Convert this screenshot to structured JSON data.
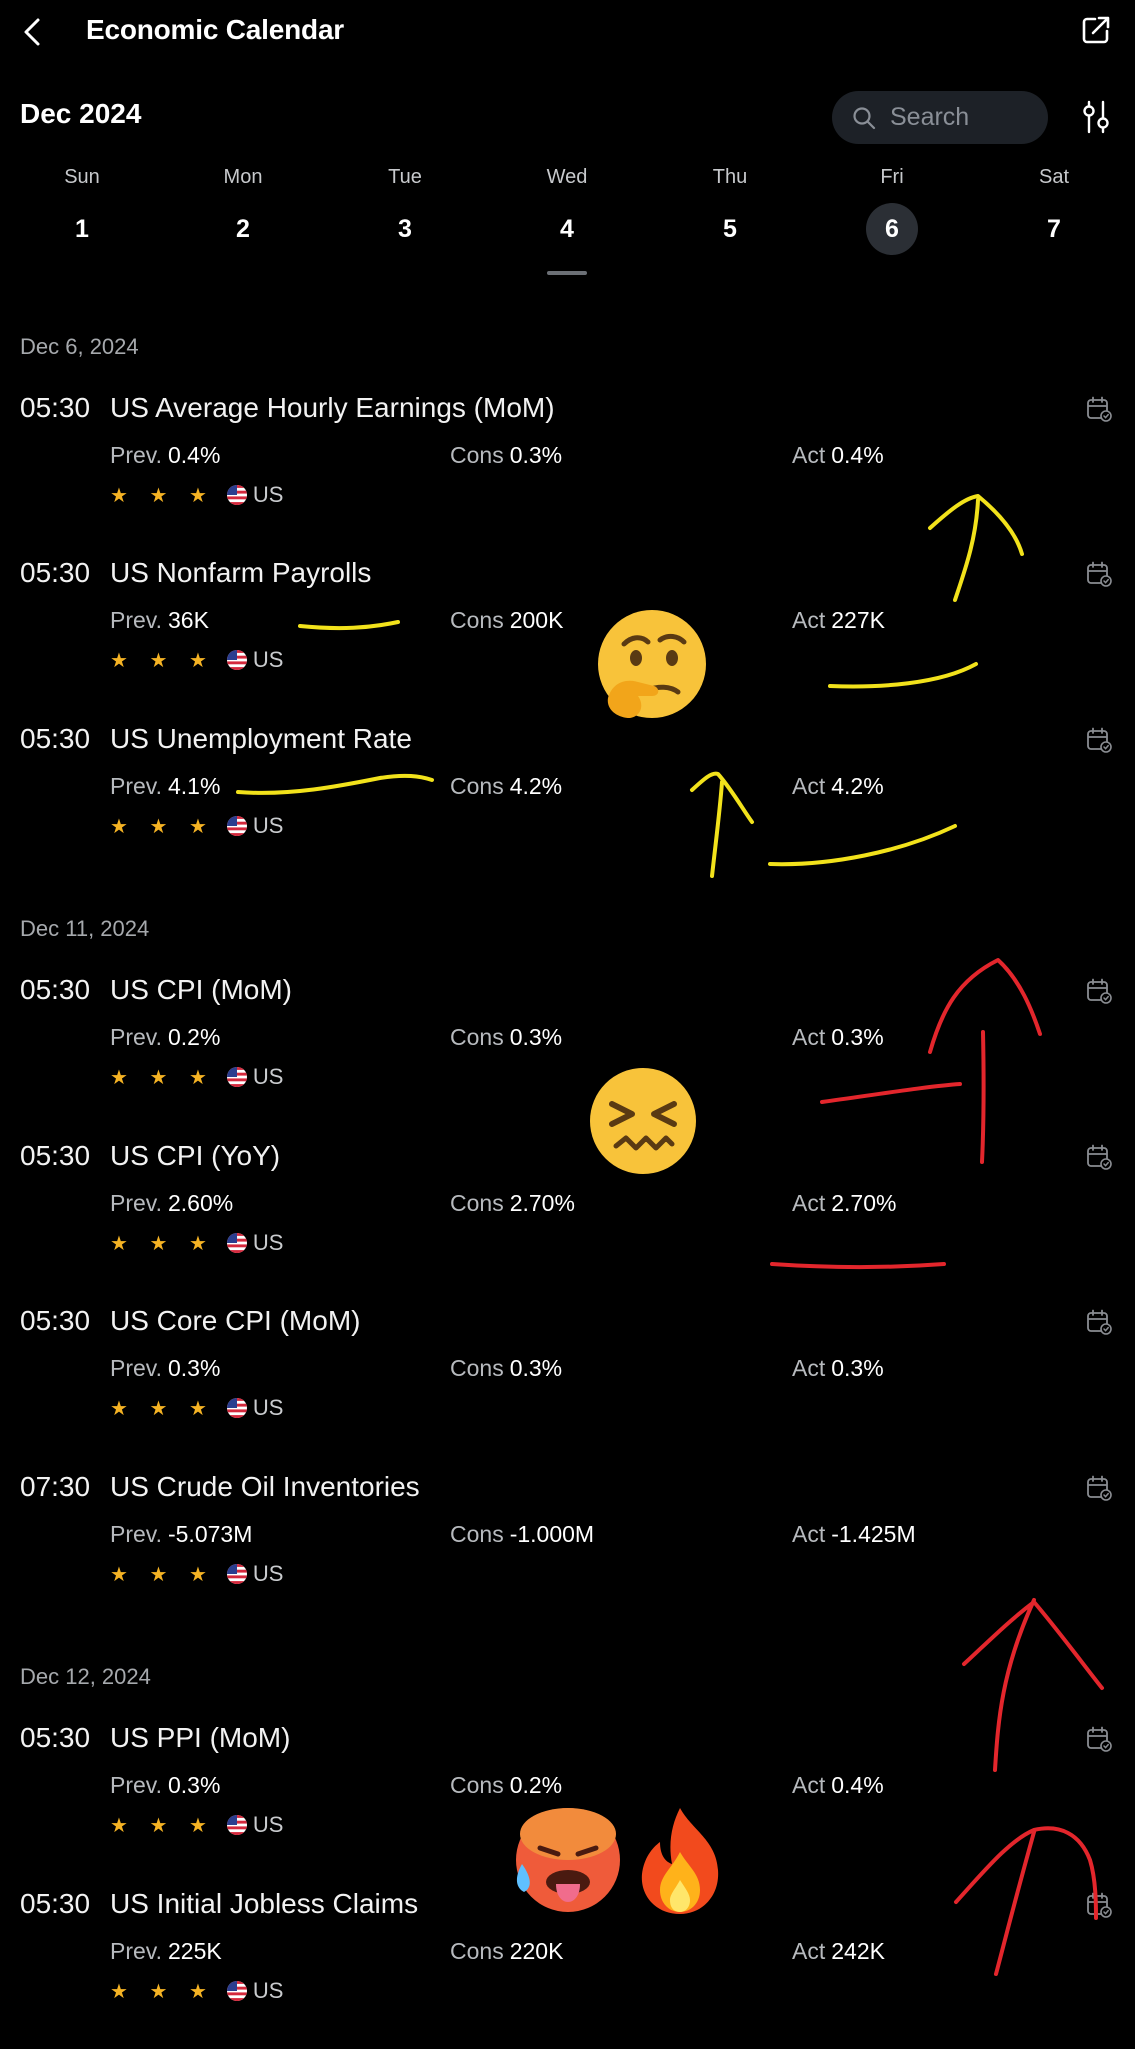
{
  "header": {
    "title": "Economic Calendar",
    "month": "Dec 2024"
  },
  "search": {
    "placeholder": "Search"
  },
  "week": [
    {
      "name": "Sun",
      "num": "1"
    },
    {
      "name": "Mon",
      "num": "2"
    },
    {
      "name": "Tue",
      "num": "3"
    },
    {
      "name": "Wed",
      "num": "4"
    },
    {
      "name": "Thu",
      "num": "5"
    },
    {
      "name": "Fri",
      "num": "6",
      "selected": true
    },
    {
      "name": "Sat",
      "num": "7"
    }
  ],
  "labels": {
    "prev": "Prev.",
    "cons": "Cons",
    "act": "Act",
    "stars": "★ ★ ★",
    "country": "US"
  },
  "groups": [
    {
      "date": "Dec 6, 2024",
      "events": [
        {
          "time": "05:30",
          "name": "US Average Hourly Earnings (MoM)",
          "prev": "0.4%",
          "cons": "0.3%",
          "act": "0.4%"
        },
        {
          "time": "05:30",
          "name": "US Nonfarm Payrolls",
          "prev": "36K",
          "cons": "200K",
          "act": "227K"
        },
        {
          "time": "05:30",
          "name": "US Unemployment Rate",
          "prev": "4.1%",
          "cons": "4.2%",
          "act": "4.2%"
        }
      ]
    },
    {
      "date": "Dec 11, 2024",
      "events": [
        {
          "time": "05:30",
          "name": "US CPI (MoM)",
          "prev": "0.2%",
          "cons": "0.3%",
          "act": "0.3%"
        },
        {
          "time": "05:30",
          "name": "US CPI (YoY)",
          "prev": "2.60%",
          "cons": "2.70%",
          "act": "2.70%"
        },
        {
          "time": "05:30",
          "name": "US Core CPI (MoM)",
          "prev": "0.3%",
          "cons": "0.3%",
          "act": "0.3%"
        },
        {
          "time": "07:30",
          "name": "US Crude Oil Inventories",
          "prev": "-5.073M",
          "cons": "-1.000M",
          "act": "-1.425M"
        }
      ]
    },
    {
      "date": "Dec 12, 2024",
      "events": [
        {
          "time": "05:30",
          "name": "US PPI (MoM)",
          "prev": "0.3%",
          "cons": "0.2%",
          "act": "0.4%"
        },
        {
          "time": "05:30",
          "name": "US Initial Jobless Claims",
          "prev": "225K",
          "cons": "220K",
          "act": "242K"
        }
      ]
    }
  ],
  "stickers": [
    "thinking-face",
    "confounded-face",
    "hot-face",
    "fire"
  ],
  "colors": {
    "accent_star": "#f5b324",
    "annotation_yellow": "#f2e21b",
    "annotation_red": "#e3262c",
    "selected_day_bg": "#2b2f35"
  }
}
